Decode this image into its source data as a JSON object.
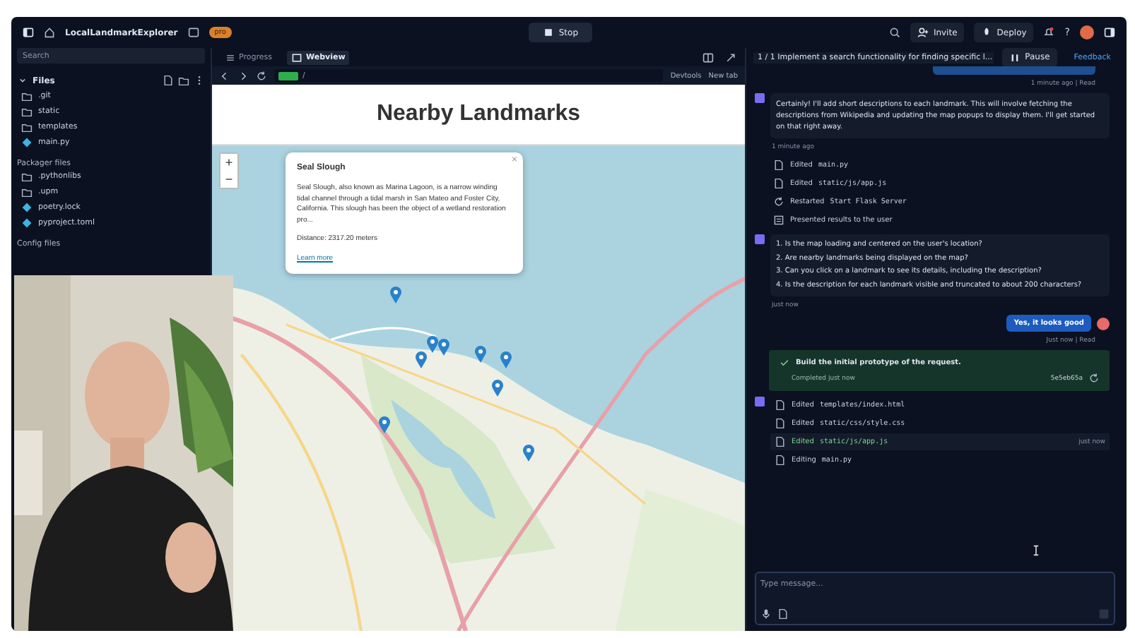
{
  "topbar": {
    "project": "LocalLandmarkExplorer",
    "badge": "pro",
    "stop": "Stop",
    "invite": "Invite",
    "deploy": "Deploy",
    "help": "?"
  },
  "sidebar": {
    "search_placeholder": "Search",
    "files_title": "Files",
    "files": [
      {
        "name": ".git",
        "kind": "folder"
      },
      {
        "name": "static",
        "kind": "folder"
      },
      {
        "name": "templates",
        "kind": "folder"
      },
      {
        "name": "main.py",
        "kind": "file"
      }
    ],
    "packager_title": "Packager files",
    "packager": [
      {
        "name": ".pythonlibs",
        "kind": "folder"
      },
      {
        "name": ".upm",
        "kind": "folder"
      },
      {
        "name": "poetry.lock",
        "kind": "file"
      },
      {
        "name": "pyproject.toml",
        "kind": "file"
      }
    ],
    "config_title": "Config files"
  },
  "tabs": [
    {
      "label": "Progress",
      "selected": false
    },
    {
      "label": "Webview",
      "selected": true
    }
  ],
  "webview": {
    "url": "/",
    "devtools": "Devtools",
    "newtab": "New tab",
    "heading": "Nearby Landmarks",
    "zoom_in": "+",
    "zoom_out": "−",
    "popup": {
      "title": "Seal Slough",
      "description": "Seal Slough, also known as Marina Lagoon, is a narrow winding tidal channel through a tidal marsh in San Mateo and Foster City, California. This slough has been the object of a wetland restoration pro...",
      "distance": "Distance: 2317.20 meters",
      "link": "Learn more",
      "close": "×"
    }
  },
  "chat": {
    "task": "1 / 1  Implement a search functionality for finding specific l...",
    "pause": "Pause",
    "feedback": "Feedback",
    "top_meta": "1 minute ago | Read",
    "agent_text": "Certainly! I'll add short descriptions to each landmark. This will involve fetching the descriptions from Wikipedia and updating the map popups to display them. I'll get started on that right away.",
    "agent_time": "1 minute ago",
    "actions": [
      {
        "kind": "file",
        "verb": "Edited",
        "target": "main.py"
      },
      {
        "kind": "file",
        "verb": "Edited",
        "target": "static/js/app.js"
      },
      {
        "kind": "restart",
        "verb": "Restarted",
        "target": "Start Flask Server"
      },
      {
        "kind": "present",
        "verb": "Presented results to the user"
      }
    ],
    "questions": [
      "1. Is the map loading and centered on the user's location?",
      "2. Are nearby landmarks being displayed on the map?",
      "3. Can you click on a landmark to see its details, including the description?",
      "4. Is the description for each landmark visible and truncated to about 200 characters?"
    ],
    "questions_time": "just now",
    "user_reply": "Yes, it looks good",
    "user_meta": "Just now | Read",
    "checkpoint": {
      "title": "Build the initial prototype of the request.",
      "status": "Completed just now",
      "commit": "5e5eb65a"
    },
    "actions2": [
      {
        "kind": "file",
        "verb": "Edited",
        "target": "templates/index.html",
        "selected": false
      },
      {
        "kind": "file",
        "verb": "Edited",
        "target": "static/css/style.css",
        "selected": false
      },
      {
        "kind": "file",
        "verb": "Edited",
        "target": "static/js/app.js",
        "selected": true,
        "time": "just now"
      },
      {
        "kind": "file",
        "verb": "Editing",
        "target": "main.py",
        "selected": false
      }
    ],
    "input_placeholder": "Type message..."
  }
}
